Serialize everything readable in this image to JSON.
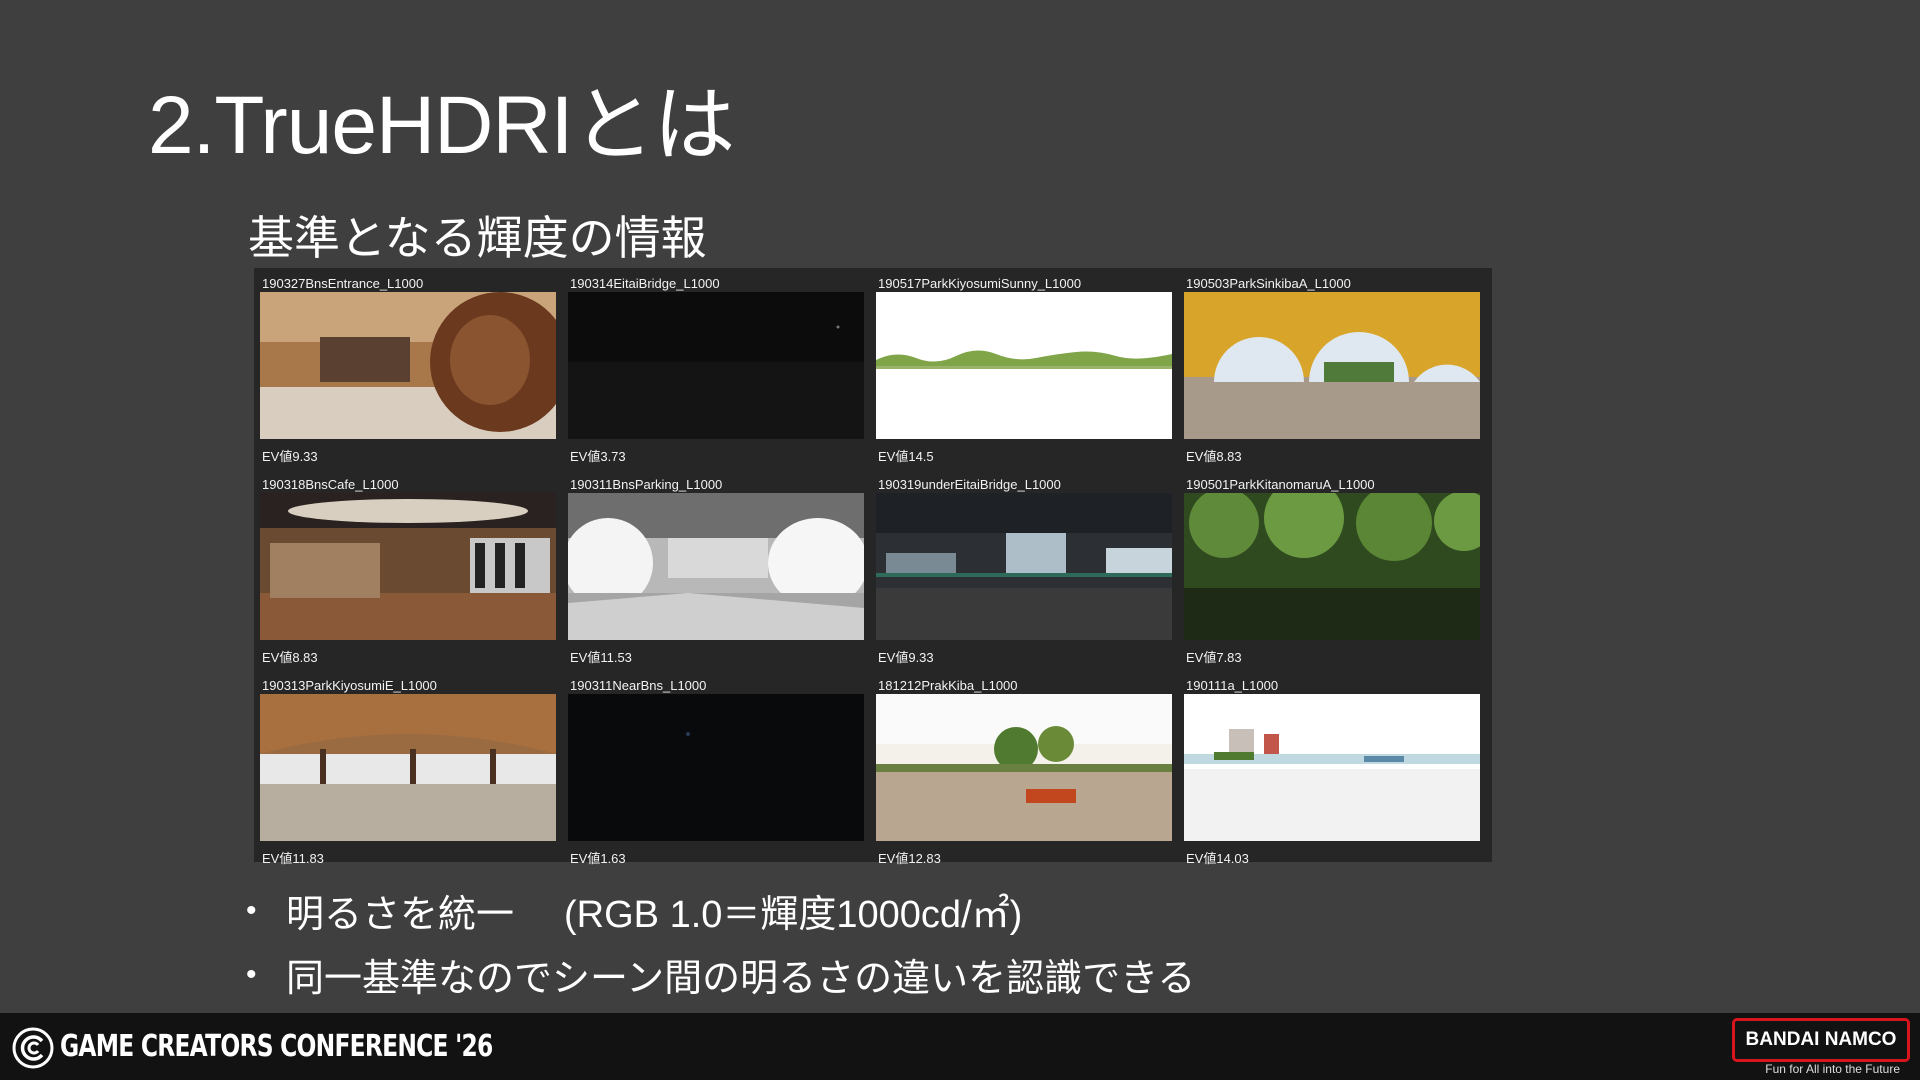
{
  "slide": {
    "title": "2.TrueHDRIとは",
    "subtitle": "基準となる輝度の情報"
  },
  "hdri_grid": [
    {
      "name": "190327BnsEntrance_L1000",
      "ev": "EV値9.33",
      "scene": "interior-lobby"
    },
    {
      "name": "190314EitaiBridge_L1000",
      "ev": "EV値3.73",
      "scene": "night-dark"
    },
    {
      "name": "190517ParkKiyosumiSunny_L1000",
      "ev": "EV値14.5",
      "scene": "overexposed-park"
    },
    {
      "name": "190503ParkSinkibaA_L1000",
      "ev": "EV値8.83",
      "scene": "yellow-canopy"
    },
    {
      "name": "190318BnsCafe_L1000",
      "ev": "EV値8.83",
      "scene": "interior-cafe"
    },
    {
      "name": "190311BnsParking_L1000",
      "ev": "EV値11.53",
      "scene": "parking-bright"
    },
    {
      "name": "190319underEitaiBridge_L1000",
      "ev": "EV値9.33",
      "scene": "under-bridge"
    },
    {
      "name": "190501ParkKitanomaruA_L1000",
      "ev": "EV値7.83",
      "scene": "forest"
    },
    {
      "name": "190313ParkKiyosumiE_L1000",
      "ev": "EV値11.83",
      "scene": "wooden-pavilion"
    },
    {
      "name": "190311NearBns_L1000",
      "ev": "EV値1.63",
      "scene": "night-very-dark"
    },
    {
      "name": "181212PrakKiba_L1000",
      "ev": "EV値12.83",
      "scene": "park-plaza"
    },
    {
      "name": "190111a_L1000",
      "ev": "EV値14.03",
      "scene": "waterfront-bright"
    }
  ],
  "bullets": {
    "dot": "•",
    "item1_main": "明るさを統一",
    "item1_note": "(RGB 1.0＝輝度1000cd/㎡)",
    "item2": "同一基準なのでシーン間の明るさの違いを認識できる"
  },
  "footer": {
    "conference": "GAME CREATORS CONFERENCE '26",
    "brand": "BANDAI NAMCO",
    "tagline": "Fun for All into the Future",
    "brand_color": "#d8141c"
  }
}
